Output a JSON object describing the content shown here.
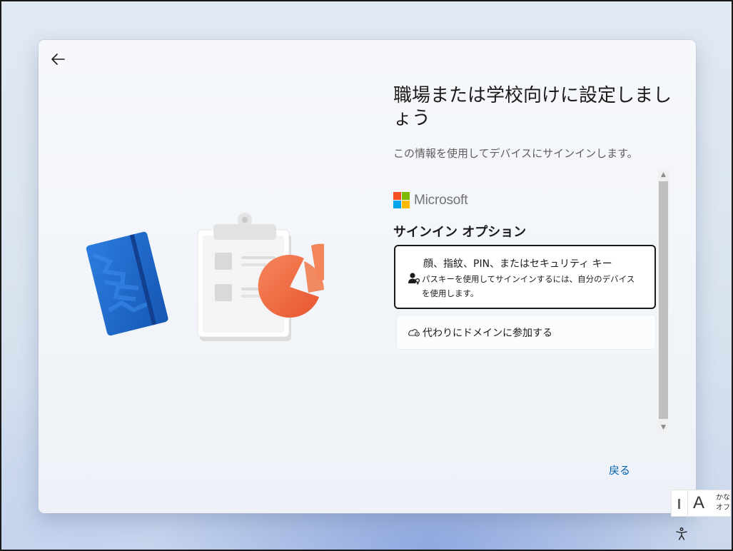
{
  "setup": {
    "title": "職場または学校向けに設定しましょう",
    "subtitle": "この情報を使用してデバイスにサインインします。",
    "brand": {
      "name": "Microsoft",
      "colors": [
        "#f25022",
        "#7fba00",
        "#00a4ef",
        "#ffb900"
      ]
    },
    "sign_in_options_heading": "サインイン オプション",
    "options": [
      {
        "title": "顔、指紋、PIN、またはセキュリティ キー",
        "description": "パスキーを使用してサインインするには、自分のデバイスを使用します。",
        "icon": "person-key-icon",
        "selected": true
      },
      {
        "title": "代わりにドメインに参加する",
        "icon": "cloud-settings-icon",
        "selected": false
      }
    ],
    "back_link": "戻る"
  },
  "taskbar": {
    "ime": {
      "mode_char": "A",
      "line1": "かな",
      "line2": "オフ"
    },
    "accessibility_icon": "accessibility-icon"
  },
  "colors": {
    "link": "#0063b1",
    "notebook_blue": "#1f6fd1",
    "pie_orange": "#f2714a"
  }
}
